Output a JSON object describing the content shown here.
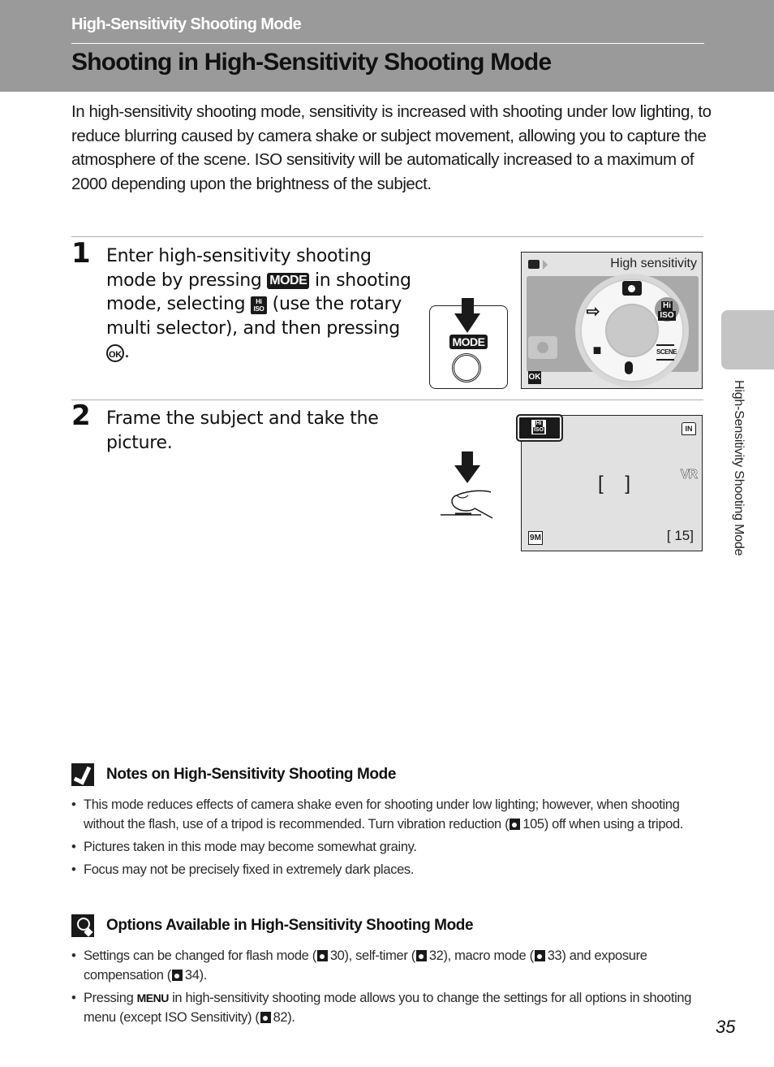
{
  "header": {
    "section_title": "High-Sensitivity Shooting Mode",
    "page_title": "Shooting in High-Sensitivity Shooting Mode"
  },
  "intro": "In high-sensitivity shooting mode, sensitivity is increased with shooting under low lighting, to reduce blurring caused by camera shake or subject movement, allowing you to capture the atmosphere of the scene. ISO sensitivity will be automatically increased to a maximum of 2000 depending upon the brightness of the subject.",
  "steps": [
    {
      "number": "1",
      "text_parts": [
        "Enter high-sensitivity shooting mode by pressing",
        "in shooting mode, selecting",
        "(use the rotary multi selector), and then pressing",
        "."
      ],
      "mode_badge": "MODE",
      "hi_iso_badge_top": "Hi",
      "hi_iso_badge_bottom": "ISO",
      "ok_badge": "OK",
      "illustration": {
        "button_label": "MODE",
        "screen_title": "High sensitivity",
        "ok_label": "OK",
        "dial_items": [
          "shooting-mode",
          "high-sensitivity",
          "scene",
          "voice-recording",
          "movie",
          "setup"
        ],
        "selected_item": "high-sensitivity",
        "hi_iso_top": "Hi",
        "hi_iso_bottom": "ISO",
        "scene_label": "SCENE"
      }
    },
    {
      "number": "2",
      "text": "Frame the subject and take the picture.",
      "illustration": {
        "mode_icon_top": "Hi",
        "mode_icon_bottom": "ISO",
        "memory_indicator": "IN",
        "vr_indicator": "VR",
        "focus_brackets": "[ ]",
        "image_size": "9M",
        "exposures_remaining": "[   15]"
      }
    }
  ],
  "notes": {
    "title": "Notes on High-Sensitivity Shooting Mode",
    "items": [
      {
        "before": "This mode reduces effects of camera shake even for shooting under low lighting; however, when shooting without the flash, use of a tripod is recommended. Turn vibration reduction (",
        "ref": "105",
        "after": ") off when using a tripod."
      },
      {
        "text": "Pictures taken in this mode may become somewhat grainy."
      },
      {
        "text": "Focus may not be precisely fixed in extremely dark places."
      }
    ]
  },
  "options": {
    "title": "Options Available in High-Sensitivity Shooting Mode",
    "item1": {
      "p1": "Settings can be changed for flash mode (",
      "r1": "30",
      "p2": "), self-timer (",
      "r2": "32",
      "p3": "), macro mode (",
      "r3": "33",
      "p4": ") and exposure compensation (",
      "r4": "34",
      "p5": ")."
    },
    "item2": {
      "p1": "Pressing ",
      "menu": "MENU",
      "p2": " in high-sensitivity shooting mode allows you to change the settings for all options in shooting menu (except ISO Sensitivity) (",
      "r1": "82",
      "p3": ")."
    }
  },
  "side_tab_label": "High-Sensitivity Shooting Mode",
  "page_number": "35"
}
